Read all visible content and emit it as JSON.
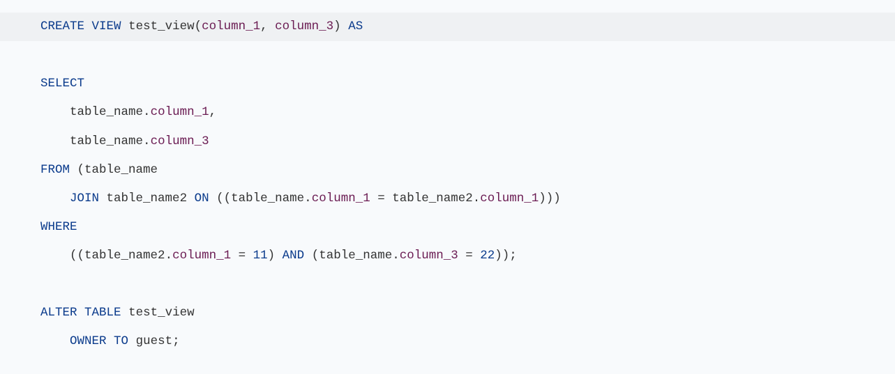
{
  "code": {
    "l1": {
      "t1": "CREATE",
      "t2": "VIEW",
      "t3": "test_view",
      "p1": "(",
      "c1": "column_1",
      "p2": ",",
      "c2": "column_3",
      "p3": ")",
      "t4": "AS"
    },
    "l2": {
      "t1": "SELECT"
    },
    "l3": {
      "t1": "table_name",
      "p1": ".",
      "c1": "column_1",
      "p2": ","
    },
    "l4": {
      "t1": "table_name",
      "p1": ".",
      "c1": "column_3"
    },
    "l5": {
      "t1": "FROM",
      "p1": "(",
      "t2": "table_name"
    },
    "l6": {
      "t1": "JOIN",
      "t2": "table_name2",
      "t3": "ON",
      "p1": "((",
      "t4": "table_name",
      "p2": ".",
      "c1": "column_1",
      "p3": " = ",
      "t5": "table_name2",
      "p4": ".",
      "c2": "column_1",
      "p5": ")))"
    },
    "l7": {
      "t1": "WHERE"
    },
    "l8": {
      "p1": "((",
      "t1": "table_name2",
      "p2": ".",
      "c1": "column_1",
      "p3": " = ",
      "n1": "11",
      "p4": ")",
      "t2": "AND",
      "p5": "(",
      "t3": "table_name",
      "p6": ".",
      "c2": "column_3",
      "p7": " = ",
      "n2": "22",
      "p8": "));"
    },
    "l9": {
      "t1": "ALTER",
      "t2": "TABLE",
      "t3": "test_view"
    },
    "l10": {
      "t1": "OWNER",
      "t2": "TO",
      "t3": "guest",
      "p1": ";"
    }
  }
}
